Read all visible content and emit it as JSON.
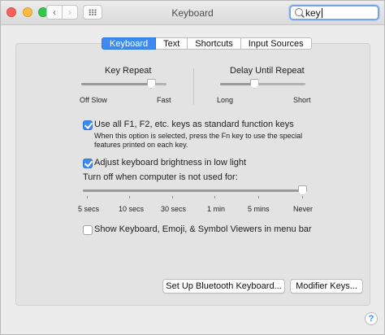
{
  "window": {
    "title": "Keyboard"
  },
  "toolbar": {
    "back_glyph": "‹",
    "forward_glyph": "›",
    "search_value": "key"
  },
  "tabs": [
    {
      "label": "Keyboard",
      "active": true
    },
    {
      "label": "Text",
      "active": false
    },
    {
      "label": "Shortcuts",
      "active": false
    },
    {
      "label": "Input Sources",
      "active": false
    }
  ],
  "key_repeat": {
    "label": "Key Repeat",
    "min_label": "Off",
    "slow_label": "Slow",
    "max_label": "Fast",
    "level": 0.82
  },
  "delay_until_repeat": {
    "label": "Delay Until Repeat",
    "min_label": "Long",
    "max_label": "Short",
    "level": 0.4
  },
  "fn_keys": {
    "checked": true,
    "label": "Use all F1, F2, etc. keys as standard function keys",
    "description_line1": "When this option is selected, press the Fn key to use the special",
    "description_line2": "features printed on each key."
  },
  "brightness": {
    "checked": true,
    "label": "Adjust keyboard brightness in low light"
  },
  "turn_off": {
    "label": "Turn off when computer is not used for:",
    "options": [
      "5 secs",
      "10 secs",
      "30 secs",
      "1 min",
      "5 mins",
      "Never"
    ],
    "selected": "Never"
  },
  "viewers": {
    "checked": false,
    "label": "Show Keyboard, Emoji, & Symbol Viewers in menu bar"
  },
  "buttons": {
    "bluetooth": "Set Up Bluetooth Keyboard...",
    "modifier": "Modifier Keys..."
  },
  "help_glyph": "?",
  "colors": {
    "accent": "#3d8bf0",
    "close": "#fc605c",
    "minimize": "#fdbc40",
    "zoom": "#34c84a"
  }
}
